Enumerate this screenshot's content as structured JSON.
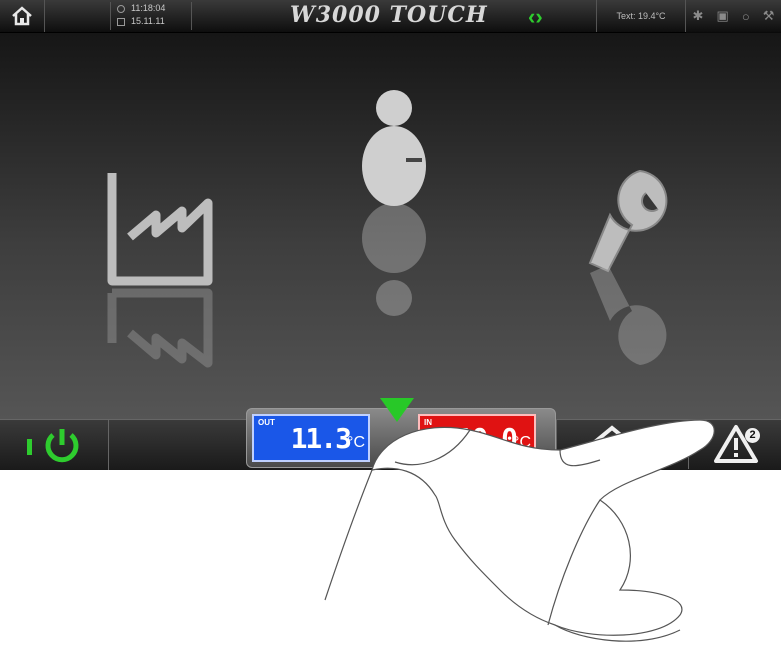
{
  "header": {
    "time": "11:18:04",
    "date": "15.11.11",
    "title": "W3000 TOUCH",
    "ext_temp": "Text: 19.4°C"
  },
  "icons": {
    "home_tab": "home-icon",
    "nav_arrows": "left-right-arrows-icon",
    "status": [
      "fan-icon",
      "compressor-icon",
      "pump-icon",
      "wrench-icon"
    ],
    "dropdown": "chevron-down-icon",
    "menu": [
      "factory-icon",
      "user-icon",
      "wrench-icon"
    ],
    "power": "power-icon",
    "home": "home-icon",
    "alarm": "warning-icon"
  },
  "bottom": {
    "out_label": "OUT",
    "out_value": "11.3",
    "out_unit": "°C",
    "in_label": "IN",
    "in_value": "10.0",
    "in_unit": "°C",
    "alarm_count": "2"
  },
  "colors": {
    "accent_green": "#28c828",
    "out_blue": "#1a57e8",
    "in_red": "#e01212"
  }
}
